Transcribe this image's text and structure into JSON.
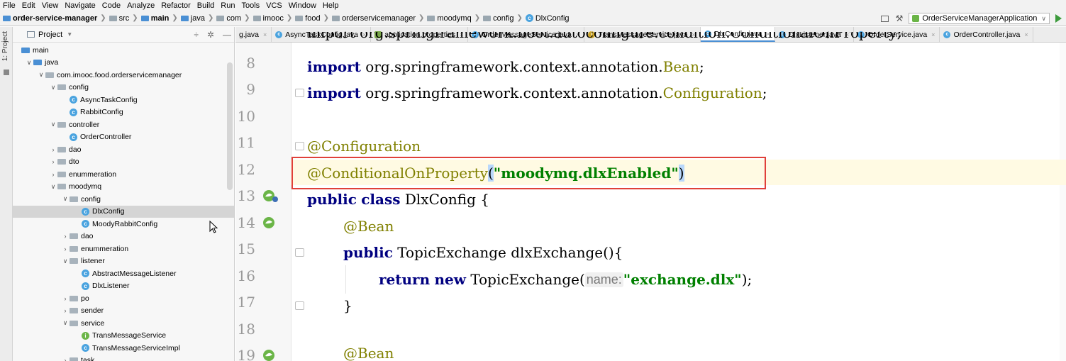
{
  "menu": [
    "File",
    "Edit",
    "View",
    "Navigate",
    "Code",
    "Analyze",
    "Refactor",
    "Build",
    "Run",
    "Tools",
    "VCS",
    "Window",
    "Help"
  ],
  "breadcrumb": [
    "order-service-manager",
    "src",
    "main",
    "java",
    "com",
    "imooc",
    "food",
    "orderservicemanager",
    "moodymq",
    "config",
    "DlxConfig"
  ],
  "run_config": {
    "label": "OrderServiceManagerApplication"
  },
  "toolstrip": {
    "label": "1: Project"
  },
  "project_panel": {
    "title": "Project"
  },
  "tree": [
    {
      "label": "main",
      "icon": "folder-blue",
      "arrow": ""
    },
    {
      "label": "java",
      "icon": "folder-blue",
      "arrow": "down"
    },
    {
      "label": "com.imooc.food.orderservicemanager",
      "icon": "folder",
      "arrow": "down"
    },
    {
      "label": "config",
      "icon": "folder",
      "arrow": "down"
    },
    {
      "label": "AsyncTaskConfig",
      "icon": "class",
      "arrow": ""
    },
    {
      "label": "RabbitConfig",
      "icon": "class",
      "arrow": ""
    },
    {
      "label": "controller",
      "icon": "folder",
      "arrow": "down"
    },
    {
      "label": "OrderController",
      "icon": "class",
      "arrow": ""
    },
    {
      "label": "dao",
      "icon": "folder",
      "arrow": "right"
    },
    {
      "label": "dto",
      "icon": "folder",
      "arrow": "right"
    },
    {
      "label": "enummeration",
      "icon": "folder",
      "arrow": "right"
    },
    {
      "label": "moodymq",
      "icon": "folder",
      "arrow": "down"
    },
    {
      "label": "config",
      "icon": "folder",
      "arrow": "down"
    },
    {
      "label": "DlxConfig",
      "icon": "class",
      "arrow": "",
      "selected": true
    },
    {
      "label": "MoodyRabbitConfig",
      "icon": "class",
      "arrow": ""
    },
    {
      "label": "dao",
      "icon": "folder",
      "arrow": "right"
    },
    {
      "label": "enummeration",
      "icon": "folder",
      "arrow": "right"
    },
    {
      "label": "listener",
      "icon": "folder",
      "arrow": "down"
    },
    {
      "label": "AbstractMessageListener",
      "icon": "class",
      "arrow": ""
    },
    {
      "label": "DlxListener",
      "icon": "class",
      "arrow": ""
    },
    {
      "label": "po",
      "icon": "folder",
      "arrow": "right"
    },
    {
      "label": "sender",
      "icon": "folder",
      "arrow": "right"
    },
    {
      "label": "service",
      "icon": "folder",
      "arrow": "down"
    },
    {
      "label": "TransMessageService",
      "icon": "interface",
      "arrow": ""
    },
    {
      "label": "TransMessageServiceImpl",
      "icon": "class",
      "arrow": ""
    },
    {
      "label": "task",
      "icon": "folder",
      "arrow": "right"
    }
  ],
  "tabs": [
    {
      "label": "g.java",
      "icon": "none"
    },
    {
      "label": "AsyncTaskConfig.java",
      "icon": "class"
    },
    {
      "label": "application.properties",
      "icon": "props"
    },
    {
      "label": "OrderMessageService.java",
      "icon": "class"
    },
    {
      "label": "TransMessageService.java",
      "icon": "interface"
    },
    {
      "label": "DlxConfig.java",
      "icon": "class",
      "active": true
    },
    {
      "label": "DlxListener.java",
      "icon": "class"
    },
    {
      "label": "OrderService.java",
      "icon": "class"
    },
    {
      "label": "OrderController.java",
      "icon": "class"
    }
  ],
  "code": {
    "line_numbers": [
      "8",
      "9",
      "10",
      "11",
      "12",
      "13",
      "14",
      "15",
      "16",
      "17",
      "18",
      "19"
    ],
    "l7_partial": "import org.springframework.boot.autoconfigure.condition.ConditionalOnProperty;",
    "l8_kw": "import",
    "l8_pkg": " org.springframework.context.annotation.",
    "l8_cls": "Bean",
    "l8_end": ";",
    "l9_kw": "import",
    "l9_pkg": " org.springframework.context.annotation.",
    "l9_cls": "Configuration",
    "l9_end": ";",
    "l11": "@Configuration",
    "l12_ann": "@ConditionalOnProperty",
    "l12_open": "(",
    "l12_str": "\"moodymq.dlxEnabled\"",
    "l12_close": ")",
    "l13_kw1": "public",
    "l13_kw2": "class",
    "l13_rest": " DlxConfig {",
    "l14": "@Bean",
    "l15_kw": "public",
    "l15_rest": " TopicExchange dlxExchange(){",
    "l16_kw1": "return",
    "l16_kw2": "new",
    "l16_cls": " TopicExchange(",
    "l16_hint": "name:",
    "l16_str": "\"exchange.dlx\"",
    "l16_end": ");",
    "l17": "}",
    "l19": "@Bean"
  }
}
